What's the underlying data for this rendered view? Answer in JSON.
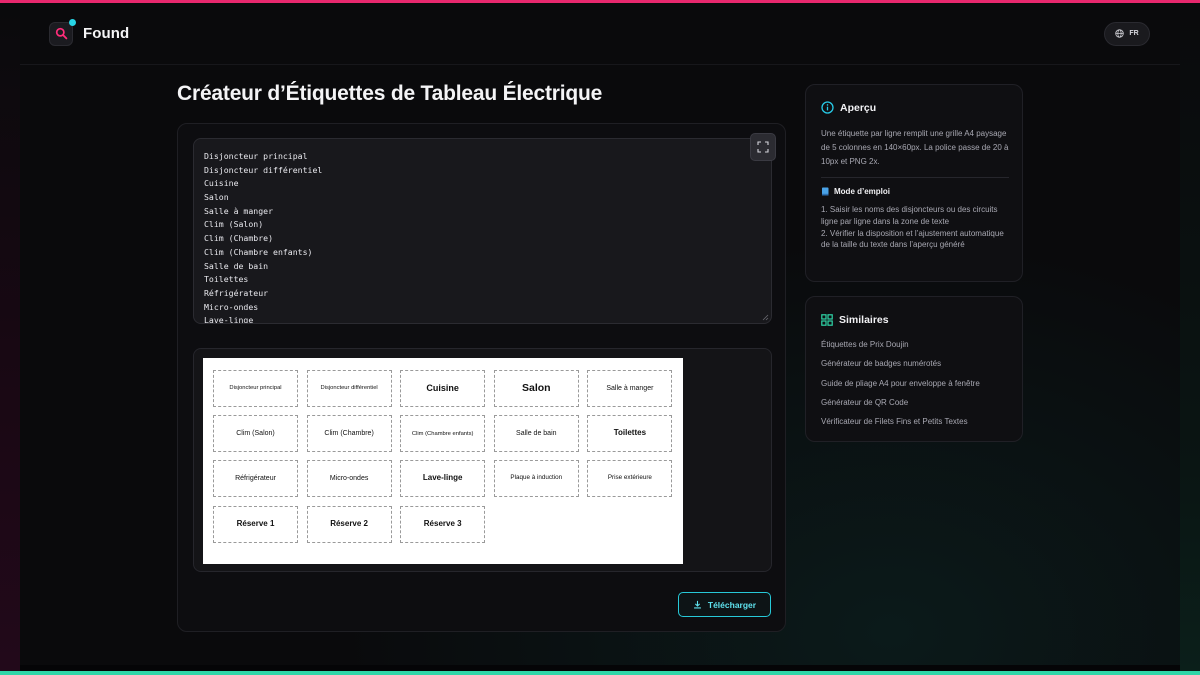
{
  "brand": {
    "name": "Found"
  },
  "language": {
    "code": "FR"
  },
  "page": {
    "title": "Créateur d’Étiquettes de Tableau Électrique"
  },
  "editor": {
    "lines": [
      "Disjoncteur principal",
      "Disjoncteur différentiel",
      "Cuisine",
      "Salon",
      "Salle à manger",
      "Clim (Salon)",
      "Clim (Chambre)",
      "Clim (Chambre enfants)",
      "Salle de bain",
      "Toilettes",
      "Réfrigérateur",
      "Micro-ondes",
      "Lave-linge"
    ]
  },
  "preview": {
    "labels": [
      "Disjoncteur principal",
      "Disjoncteur différentiel",
      "Cuisine",
      "Salon",
      "Salle à manger",
      "Clim (Salon)",
      "Clim (Chambre)",
      "Clim (Chambre enfants)",
      "Salle de bain",
      "Toilettes",
      "Réfrigérateur",
      "Micro-ondes",
      "Lave-linge",
      "Plaque à induction",
      "Prise extérieure",
      "Réserve 1",
      "Réserve 2",
      "Réserve 3"
    ]
  },
  "actions": {
    "download_label": "Télécharger"
  },
  "overview": {
    "title": "Aperçu",
    "description": "Une étiquette par ligne remplit une grille A4 paysage de 5 colonnes en 140×60px. La police passe de 20 à 10px et PNG 2x.",
    "howto_title": "Mode d’emploi",
    "step1": "1. Saisir les noms des disjoncteurs ou des circuits ligne par ligne dans la zone de texte",
    "step2": "2. Vérifier la disposition et l’ajustement automatique de la taille du texte dans l’aperçu généré"
  },
  "similar": {
    "title": "Similaires",
    "items": [
      "Étiquettes de Prix Doujin",
      "Générateur de badges numérotés",
      "Guide de pliage A4 pour enveloppe à fenêtre",
      "Générateur de QR Code",
      "Vérificateur de Filets Fins et Petits Textes"
    ]
  },
  "colors": {
    "accent_pink": "#e8286e",
    "accent_cyan": "#27c9d8",
    "accent_green": "#2fd6a8"
  },
  "icons": {
    "brand": "search-icon",
    "language": "globe-icon",
    "expand": "expand-icon",
    "download": "download-icon",
    "overview": "info-icon",
    "howto": "book-icon",
    "similar": "grid-icon"
  }
}
